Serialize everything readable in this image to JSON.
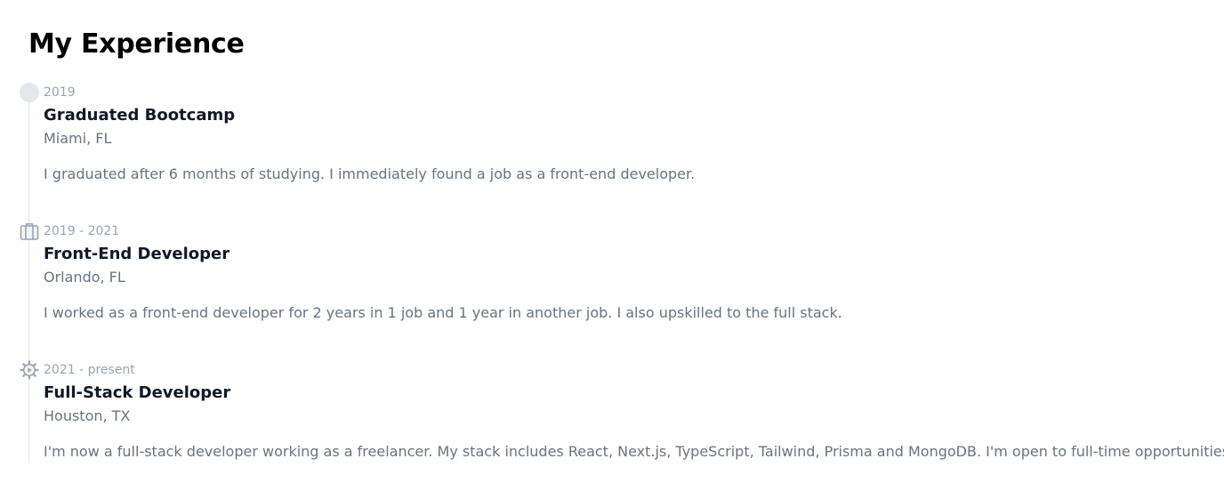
{
  "page": {
    "title": "My Experience"
  },
  "experience": [
    {
      "date": "2019",
      "title": "Graduated Bootcamp",
      "location": "Miami, FL",
      "description": "I graduated after 6 months of studying. I immediately found a job as a front-end developer.",
      "icon": "dot-icon"
    },
    {
      "date": "2019 - 2021",
      "title": "Front-End Developer",
      "location": "Orlando, FL",
      "description": "I worked as a front-end developer for 2 years in 1 job and 1 year in another job. I also upskilled to the full stack.",
      "icon": "briefcase-icon"
    },
    {
      "date": "2021 - present",
      "title": "Full-Stack Developer",
      "location": "Houston, TX",
      "description": "I'm now a full-stack developer working as a freelancer. My stack includes React, Next.js, TypeScript, Tailwind, Prisma and MongoDB. I'm open to full-time opportunities.",
      "icon": "gear-icon"
    }
  ],
  "colors": {
    "timeline_line": "#e5e7eb",
    "muted_text": "#6b7280",
    "date_text": "#9ca3af",
    "heading_text": "#111827",
    "icon": "#9ca3af"
  }
}
